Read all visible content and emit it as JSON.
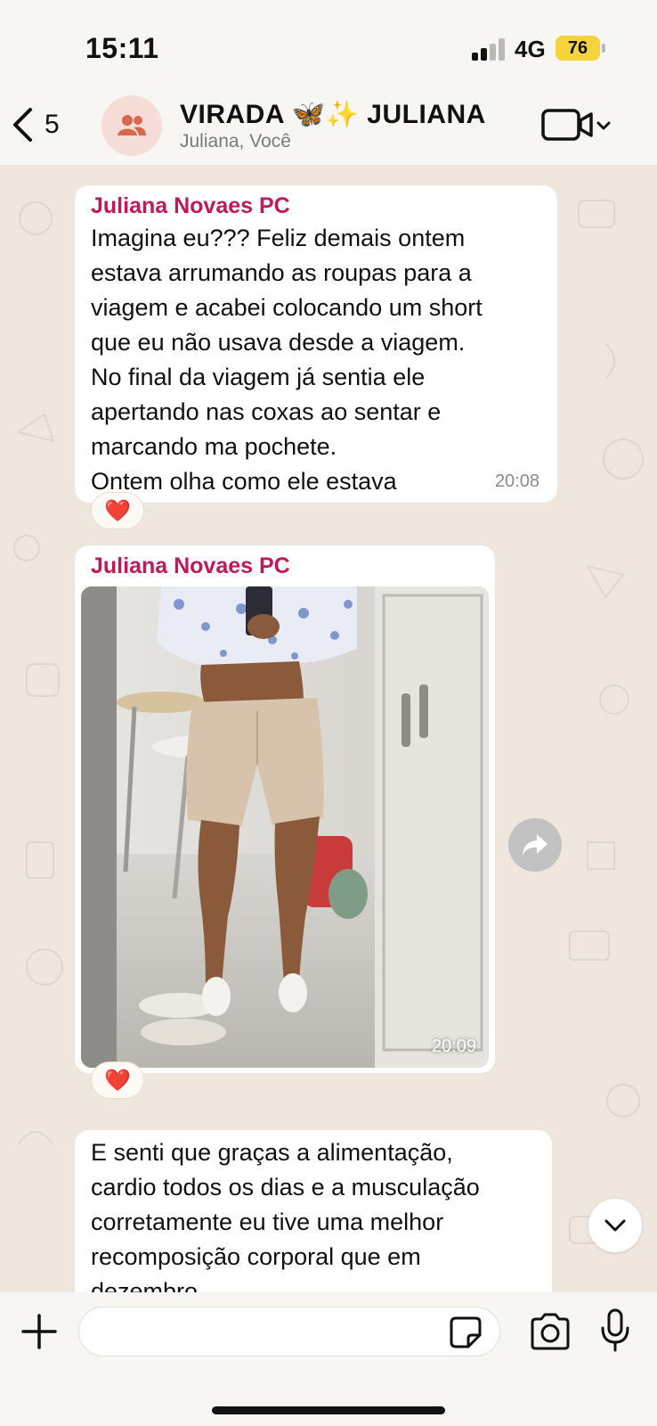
{
  "status_bar": {
    "time": "15:11",
    "network": "4G",
    "battery": "76"
  },
  "header": {
    "back_count": "5",
    "title": "VIRADA 🦋✨ JULIANA",
    "subtitle": "Juliana, Você",
    "avatar_icon": "group-icon",
    "video_icon": "video-camera-icon"
  },
  "messages": [
    {
      "sender": "Juliana Novaes PC",
      "text": "Imagina eu??? Feliz demais ontem\nestava arrumando as roupas para a\nviagem e acabei colocando um short\nque eu não usava desde a viagem.\nNo final da viagem já sentia ele\napertando nas coxas ao sentar e\nmarcando ma pochete.\nOntem olha como ele estava",
      "time": "20:08",
      "reaction": "❤️"
    },
    {
      "sender": "Juliana Novaes PC",
      "type": "photo",
      "time": "20:09",
      "reaction": "❤️"
    },
    {
      "text": "E senti que graças a alimentação,\ncardio todos os dias e a musculação\ncorretamente eu tive uma melhor\nrecomposição corporal que em\ndezembro"
    }
  ],
  "composer": {
    "placeholder": "",
    "icons": [
      "plus-icon",
      "sticker-icon",
      "camera-icon",
      "microphone-icon"
    ]
  },
  "colors": {
    "sender_name": "#c2185b",
    "chat_background": "#efe7de",
    "bubble": "#ffffff",
    "battery": "#f6d33c"
  }
}
